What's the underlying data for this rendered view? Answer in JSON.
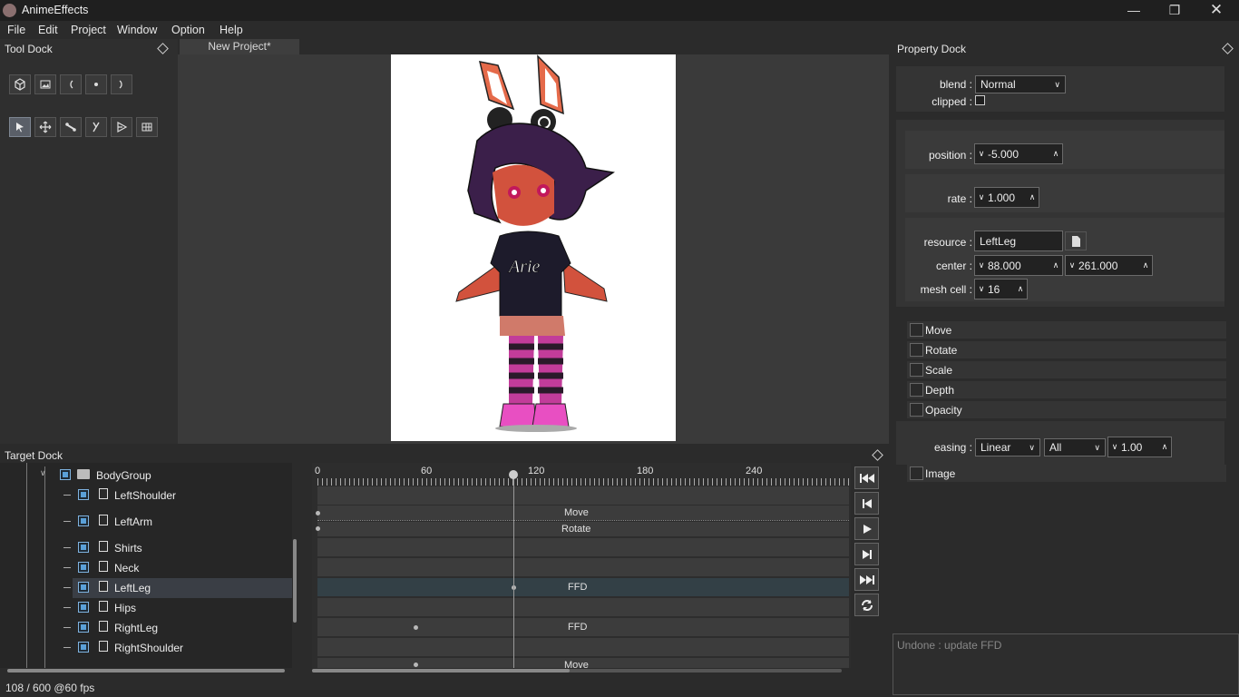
{
  "app": {
    "title": "AnimeEffects"
  },
  "menu": [
    "File",
    "Edit",
    "Project",
    "Window",
    "Option",
    "Help"
  ],
  "tool_dock": {
    "title": "Tool Dock"
  },
  "tabs": [
    {
      "label": "New Project*"
    }
  ],
  "property_dock": {
    "title": "Property Dock",
    "blend_label": "blend :",
    "blend_value": "Normal",
    "clipped_label": "clipped :",
    "position_label": "position :",
    "position_value": "-5.000",
    "rate_label": "rate :",
    "rate_value": "1.000",
    "resource_label": "resource :",
    "resource_value": "LeftLeg",
    "center_label": "center :",
    "center_x": "88.000",
    "center_y": "261.000",
    "meshcell_label": "mesh cell :",
    "meshcell_value": "16",
    "keys": [
      "Move",
      "Rotate",
      "Scale",
      "Depth",
      "Opacity"
    ],
    "easing_label": "easing :",
    "easing_type": "Linear",
    "easing_range": "All",
    "easing_weight": "1.00",
    "image_label": "Image"
  },
  "target_dock": {
    "title": "Target Dock",
    "group": "BodyGroup",
    "layers": [
      "LeftShoulder",
      "LeftArm",
      "Shirts",
      "Neck",
      "LeftLeg",
      "Hips",
      "RightLeg",
      "RightShoulder"
    ],
    "selected_layer": "LeftLeg"
  },
  "timeline": {
    "ticks": [
      "0",
      "60",
      "120",
      "180",
      "240"
    ],
    "tracks": [
      "Move",
      "Rotate",
      "FFD",
      "FFD",
      "Move"
    ]
  },
  "undo": {
    "text": "Undone : update FFD"
  },
  "status": {
    "text": "108 / 600 @60 fps"
  }
}
